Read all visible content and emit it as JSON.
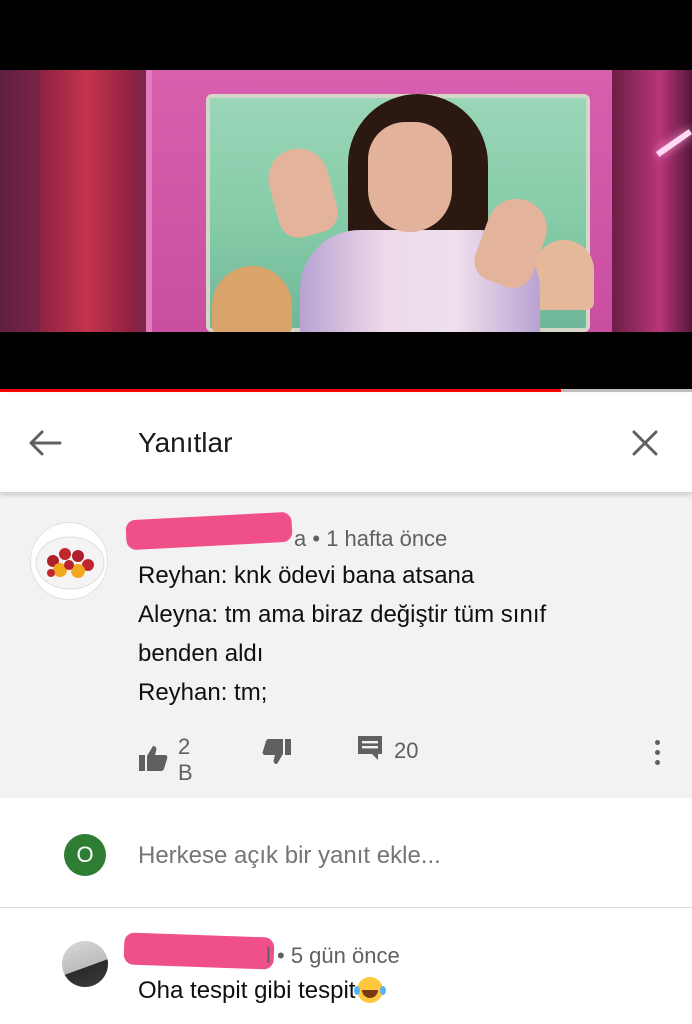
{
  "video": {
    "progress": 0.81
  },
  "header": {
    "title": "Yanıtlar",
    "back_icon": "arrow-left-icon",
    "close_icon": "close-icon"
  },
  "main_comment": {
    "author_suffix": "a",
    "time": "• 1 hafta önce",
    "lines": [
      "Reyhan: knk ödevi bana atsana",
      "Aleyna: tm ama biraz değiştir tüm sınıf",
      "benden aldı",
      "Reyhan: tm;"
    ],
    "likes": "2 B",
    "replies": "20",
    "like_icon": "thumbs-up-icon",
    "dislike_icon": "thumbs-down-icon",
    "reply_icon": "comment-icon",
    "more_icon": "more-vert-icon"
  },
  "reply_box": {
    "user_initial": "O",
    "placeholder": "Herkese açık bir yanıt ekle..."
  },
  "reply_comment": {
    "author_suffix": "l",
    "time": "• 5 gün önce",
    "text": "Oha tespit gibi tespit",
    "emoji_icon": "laughing-tears-emoji-icon"
  },
  "colors": {
    "accent": "#ff0000",
    "redaction": "#f0508a",
    "avatar_bg": "#2e7d32"
  }
}
